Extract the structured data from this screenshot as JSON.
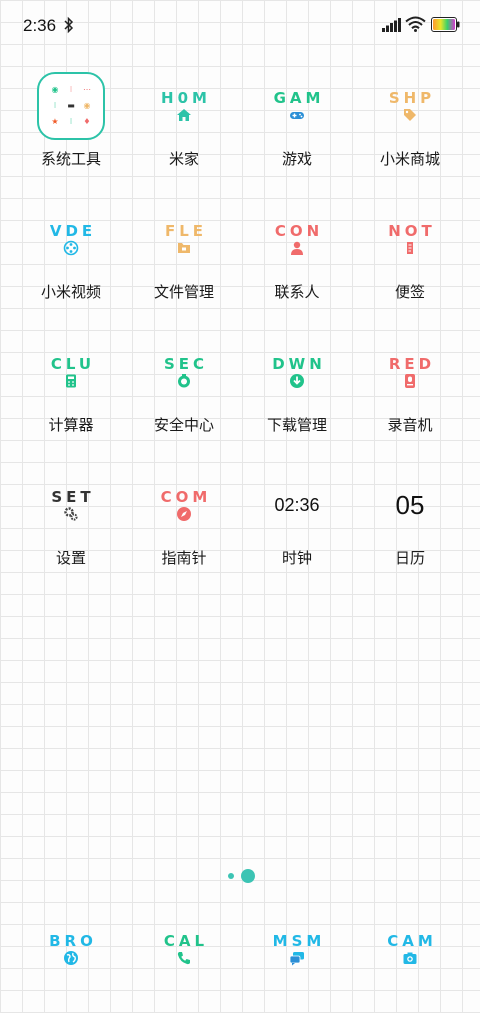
{
  "status_bar": {
    "time": "2:36"
  },
  "colors": {
    "teal": "#2cc3a8",
    "green": "#21c38b",
    "cyan": "#21b8e6",
    "orange": "#efb86a",
    "red": "#f06b6b",
    "dark": "#333333"
  },
  "apps": [
    {
      "abbr": "",
      "label": "系统工具",
      "color": "#2cc3a8",
      "icon": "folder-grid-icon"
    },
    {
      "abbr": "H0M",
      "label": "米家",
      "color": "#2cc3a8",
      "icon": "home-icon"
    },
    {
      "abbr": "GAM",
      "label": "游戏",
      "color": "#21c38b",
      "icon": "gamepad-icon"
    },
    {
      "abbr": "SHP",
      "label": "小米商城",
      "color": "#efb86a",
      "icon": "tag-icon"
    },
    {
      "abbr": "VDE",
      "label": "小米视频",
      "color": "#21b8e6",
      "icon": "film-reel-icon"
    },
    {
      "abbr": "FLE",
      "label": "文件管理",
      "color": "#efb86a",
      "icon": "folder-icon"
    },
    {
      "abbr": "CON",
      "label": "联系人",
      "color": "#f06b6b",
      "icon": "person-icon"
    },
    {
      "abbr": "NOT",
      "label": "便签",
      "color": "#f06b6b",
      "icon": "note-icon"
    },
    {
      "abbr": "CLU",
      "label": "计算器",
      "color": "#21c38b",
      "icon": "calculator-icon"
    },
    {
      "abbr": "SEC",
      "label": "安全中心",
      "color": "#21c38b",
      "icon": "shield-icon"
    },
    {
      "abbr": "DWN",
      "label": "下载管理",
      "color": "#21c38b",
      "icon": "download-icon"
    },
    {
      "abbr": "RED",
      "label": "录音机",
      "color": "#f06b6b",
      "icon": "recorder-icon"
    },
    {
      "abbr": "SET",
      "label": "设置",
      "color": "#333333",
      "icon": "gear-icon"
    },
    {
      "abbr": "COM",
      "label": "指南针",
      "color": "#f06b6b",
      "icon": "compass-icon"
    },
    {
      "abbr": "",
      "label": "时钟",
      "widget": "02:36",
      "icon": ""
    },
    {
      "abbr": "",
      "label": "日历",
      "widget": "05",
      "icon": ""
    }
  ],
  "dock": [
    {
      "abbr": "BRO",
      "color": "#21b8e6",
      "icon": "globe-icon"
    },
    {
      "abbr": "CAL",
      "color": "#21c38b",
      "icon": "phone-icon"
    },
    {
      "abbr": "MSM",
      "color": "#21b8e6",
      "icon": "message-icon"
    },
    {
      "abbr": "CAM",
      "color": "#21b8e6",
      "icon": "camera-icon"
    }
  ],
  "page_indicator": {
    "pages": 2,
    "current": 2
  }
}
